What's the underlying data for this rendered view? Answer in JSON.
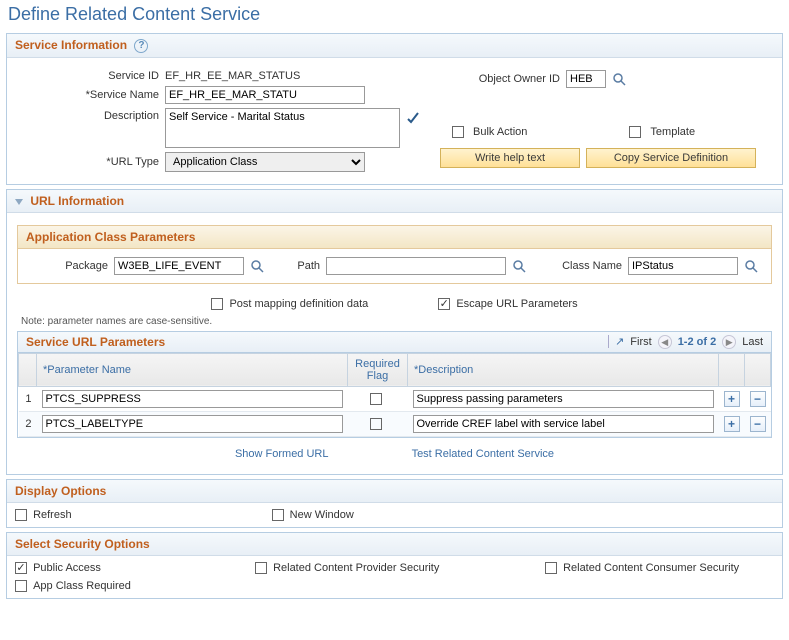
{
  "page_title": "Define Related Content Service",
  "service_info": {
    "header": "Service Information",
    "service_id_label": "Service ID",
    "service_id": "EF_HR_EE_MAR_STATUS",
    "service_name_label": "Service Name",
    "service_name": "EF_HR_EE_MAR_STATU",
    "object_owner_label": "Object Owner ID",
    "object_owner": "HEB",
    "description_label": "Description",
    "description": "Self Service - Marital Status",
    "bulk_action_label": "Bulk Action",
    "template_label": "Template",
    "url_type_label": "URL Type",
    "url_type": "Application Class",
    "btn_help": "Write help text",
    "btn_copy": "Copy Service Definition"
  },
  "url_info": {
    "header": "URL Information",
    "app_class_header": "Application Class Parameters",
    "package_label": "Package",
    "package": "W3EB_LIFE_EVENT",
    "path_label": "Path",
    "path": "",
    "class_name_label": "Class Name",
    "class_name": "IPStatus",
    "post_mapping_label": "Post mapping definition data",
    "escape_url_label": "Escape URL Parameters",
    "note": "Note: parameter names are case-sensitive.",
    "grid_title": "Service URL Parameters",
    "nav_first": "First",
    "nav_range": "1-2 of 2",
    "nav_last": "Last",
    "col_param": "Parameter Name",
    "col_req": "Required Flag",
    "col_desc": "Description",
    "rows": [
      {
        "num": "1",
        "name": "PTCS_SUPPRESS",
        "desc": "Suppress passing parameters"
      },
      {
        "num": "2",
        "name": "PTCS_LABELTYPE",
        "desc": "Override CREF label with service label"
      }
    ],
    "link_show": "Show Formed URL",
    "link_test": "Test Related Content Service"
  },
  "display_options": {
    "header": "Display Options",
    "refresh_label": "Refresh",
    "new_window_label": "New Window"
  },
  "security": {
    "header": "Select Security Options",
    "public_access": "Public Access",
    "provider_sec": "Related Content Provider Security",
    "consumer_sec": "Related Content Consumer Security",
    "app_class_req": "App Class Required"
  }
}
